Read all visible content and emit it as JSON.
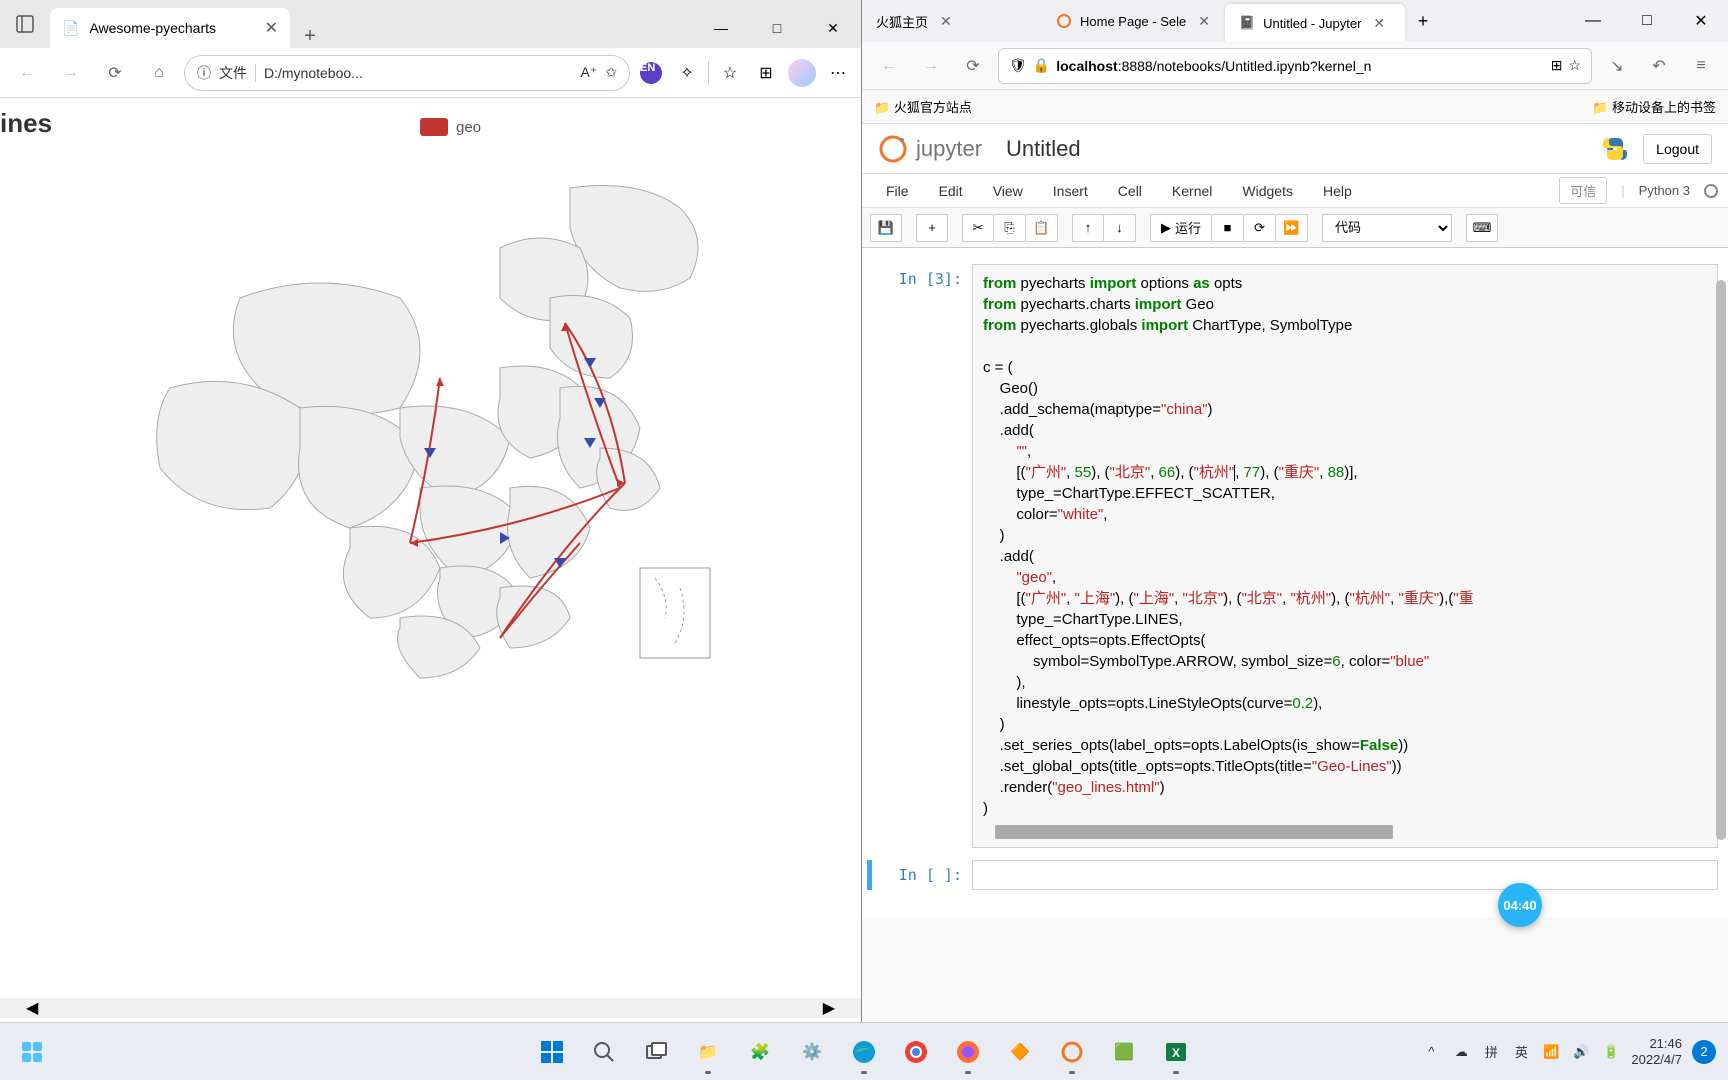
{
  "left": {
    "tab_title": "Awesome-pyecharts",
    "address_label": "文件",
    "address_path": "D:/mynoteboo...",
    "map_title_cut": "ines",
    "legend_label": "geo"
  },
  "right": {
    "tabs": [
      {
        "label": "火狐主页",
        "active": false
      },
      {
        "label": "Home Page - Sele",
        "active": false
      },
      {
        "label": "Untitled - Jupyter",
        "active": true
      }
    ],
    "address_url": "localhost:8888/notebooks/Untitled.ipynb?kernel_n",
    "address_host": "localhost",
    "bookmarks_left": "火狐官方站点",
    "bookmarks_right": "移动设备上的书签"
  },
  "jupyter": {
    "logo_text": "jupyter",
    "title": "Untitled",
    "logout": "Logout",
    "menus": [
      "File",
      "Edit",
      "View",
      "Insert",
      "Cell",
      "Kernel",
      "Widgets",
      "Help"
    ],
    "trusted": "可信",
    "kernel": "Python 3",
    "run_label": "运行",
    "cell_type": "代码",
    "cell_prompt": "In  [3]:",
    "empty_prompt": "In  [ ]:",
    "code_lines": [
      [
        {
          "t": "from ",
          "c": "kw"
        },
        {
          "t": "pyecharts "
        },
        {
          "t": "import ",
          "c": "kw"
        },
        {
          "t": "options "
        },
        {
          "t": "as ",
          "c": "kw"
        },
        {
          "t": "opts"
        }
      ],
      [
        {
          "t": "from ",
          "c": "kw"
        },
        {
          "t": "pyecharts.charts "
        },
        {
          "t": "import ",
          "c": "kw"
        },
        {
          "t": "Geo"
        }
      ],
      [
        {
          "t": "from ",
          "c": "kw"
        },
        {
          "t": "pyecharts.globals "
        },
        {
          "t": "import ",
          "c": "kw"
        },
        {
          "t": "ChartType, SymbolType"
        }
      ],
      [
        {
          "t": ""
        }
      ],
      [
        {
          "t": "c = ("
        }
      ],
      [
        {
          "t": "    Geo()"
        }
      ],
      [
        {
          "t": "    .add_schema(maptype="
        },
        {
          "t": "\"china\"",
          "c": "str"
        },
        {
          "t": ")"
        }
      ],
      [
        {
          "t": "    .add("
        }
      ],
      [
        {
          "t": "        "
        },
        {
          "t": "\"\"",
          "c": "str"
        },
        {
          "t": ","
        }
      ],
      [
        {
          "t": "        [("
        },
        {
          "t": "\"广州\"",
          "c": "str"
        },
        {
          "t": ", "
        },
        {
          "t": "55",
          "c": "num"
        },
        {
          "t": "), ("
        },
        {
          "t": "\"北京\"",
          "c": "str"
        },
        {
          "t": ", "
        },
        {
          "t": "66",
          "c": "num"
        },
        {
          "t": "), ("
        },
        {
          "t": "\"杭州\"",
          "c": "str",
          "cursor": true
        },
        {
          "t": ", "
        },
        {
          "t": "77",
          "c": "num"
        },
        {
          "t": "), ("
        },
        {
          "t": "\"重庆\"",
          "c": "str"
        },
        {
          "t": ", "
        },
        {
          "t": "88",
          "c": "num"
        },
        {
          "t": ")],"
        }
      ],
      [
        {
          "t": "        type_=ChartType.EFFECT_SCATTER,"
        }
      ],
      [
        {
          "t": "        color="
        },
        {
          "t": "\"white\"",
          "c": "str"
        },
        {
          "t": ","
        }
      ],
      [
        {
          "t": "    )"
        }
      ],
      [
        {
          "t": "    .add("
        }
      ],
      [
        {
          "t": "        "
        },
        {
          "t": "\"geo\"",
          "c": "str"
        },
        {
          "t": ","
        }
      ],
      [
        {
          "t": "        [("
        },
        {
          "t": "\"广州\"",
          "c": "str"
        },
        {
          "t": ", "
        },
        {
          "t": "\"上海\"",
          "c": "str"
        },
        {
          "t": "), ("
        },
        {
          "t": "\"上海\"",
          "c": "str"
        },
        {
          "t": ", "
        },
        {
          "t": "\"北京\"",
          "c": "str"
        },
        {
          "t": "), ("
        },
        {
          "t": "\"北京\"",
          "c": "str"
        },
        {
          "t": ", "
        },
        {
          "t": "\"杭州\"",
          "c": "str"
        },
        {
          "t": "), ("
        },
        {
          "t": "\"杭州\"",
          "c": "str"
        },
        {
          "t": ", "
        },
        {
          "t": "\"重庆\"",
          "c": "str"
        },
        {
          "t": "),("
        },
        {
          "t": "\"重",
          "c": "str"
        }
      ],
      [
        {
          "t": "        type_=ChartType.LINES,"
        }
      ],
      [
        {
          "t": "        effect_opts=opts.EffectOpts("
        }
      ],
      [
        {
          "t": "            symbol=SymbolType.ARROW, symbol_size="
        },
        {
          "t": "6",
          "c": "num"
        },
        {
          "t": ", color="
        },
        {
          "t": "\"blue\"",
          "c": "str"
        }
      ],
      [
        {
          "t": "        ),"
        }
      ],
      [
        {
          "t": "        linestyle_opts=opts.LineStyleOpts(curve="
        },
        {
          "t": "0.2",
          "c": "num"
        },
        {
          "t": "),"
        }
      ],
      [
        {
          "t": "    )"
        }
      ],
      [
        {
          "t": "    .set_series_opts(label_opts=opts.LabelOpts(is_show="
        },
        {
          "t": "False",
          "c": "bool"
        },
        {
          "t": "))"
        }
      ],
      [
        {
          "t": "    .set_global_opts(title_opts=opts.TitleOpts(title="
        },
        {
          "t": "\"Geo-Lines\"",
          "c": "str"
        },
        {
          "t": "))"
        }
      ],
      [
        {
          "t": "    .render("
        },
        {
          "t": "\"geo_lines.html\"",
          "c": "str"
        },
        {
          "t": ")"
        }
      ],
      [
        {
          "t": ")"
        }
      ]
    ]
  },
  "bubble_time": "04:40",
  "taskbar": {
    "tray": {
      "ime1": "拼",
      "ime2": "英"
    },
    "time": "21:46",
    "date": "2022/4/7",
    "notif_count": "2"
  }
}
